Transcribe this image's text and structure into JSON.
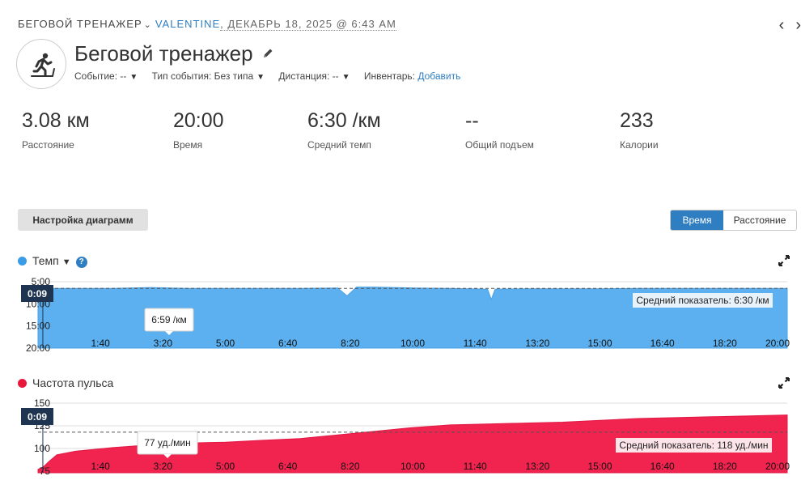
{
  "header": {
    "activity_name": "БЕГОВОЙ ТРЕНАЖЕР",
    "user": "VALENTINE",
    "date_time": ", ДЕКАБРЬ 18, 2025 @ 6:43 AM",
    "prev_symbol": "‹",
    "next_symbol": "›"
  },
  "activity": {
    "title": "Беговой тренажер",
    "icon": "treadmill-runner-icon",
    "meta": {
      "event_label": "Событие: --",
      "event_type_label": "Тип события: Без типа",
      "distance_label": "Дистанция: --",
      "gear_label": "Инвентарь:",
      "gear_link": "Добавить"
    }
  },
  "stats": [
    {
      "value": "3.08 км",
      "label": "Расстояние"
    },
    {
      "value": "20:00",
      "label": "Время"
    },
    {
      "value": "6:30 /км",
      "label": "Средний темп"
    },
    {
      "value": "--",
      "label": "Общий подъем"
    },
    {
      "value": "233",
      "label": "Калории"
    }
  ],
  "controls": {
    "settings_button": "Настройка диаграмм",
    "x_axis_time": "Время",
    "x_axis_distance": "Расстояние"
  },
  "colors": {
    "accent": "#2f7ec1",
    "pace": "#5cb0ef",
    "pace_dot": "#3a9be6",
    "heart_rate": "#f0244e",
    "heart_rate_dot": "#e8173c",
    "marker_bg": "#1e3450"
  },
  "chart_data": [
    {
      "type": "area",
      "title": "Темп",
      "unit": "/км",
      "y_ticks": [
        "5:00",
        "10:00",
        "15:00",
        "20:00"
      ],
      "y_tick_minutes": [
        5,
        10,
        15,
        20
      ],
      "y_inverted": true,
      "x_ticks": [
        "1:40",
        "3:20",
        "5:00",
        "6:40",
        "8:20",
        "10:00",
        "11:40",
        "13:20",
        "15:00",
        "16:40",
        "18:20",
        "20:00"
      ],
      "x_minutes": [
        0,
        1,
        2,
        3,
        4,
        5,
        6,
        7,
        8,
        8.25,
        8.5,
        9,
        10,
        11,
        12,
        12.1,
        12.2,
        13,
        14,
        15,
        16,
        17,
        18,
        19,
        20
      ],
      "pace_minutes": [
        6.5,
        6.5,
        6.5,
        6.3,
        6.5,
        6.5,
        6.5,
        6.5,
        6.4,
        8.2,
        6.2,
        6.2,
        6.4,
        6.5,
        6.7,
        9.0,
        6.7,
        6.6,
        6.6,
        6.6,
        6.5,
        6.5,
        6.5,
        6.5,
        6.5
      ],
      "average_label": "Средний показатель: 6:30 /км",
      "average_value": 6.5,
      "marker_label": "0:09",
      "tooltip": "6:59 /км"
    },
    {
      "type": "area",
      "title": "Частота пульса",
      "unit": "уд./мин",
      "y_ticks": [
        "150",
        "125",
        "100",
        "75"
      ],
      "y_tick_values": [
        150,
        125,
        100,
        75
      ],
      "ylim": [
        75,
        150
      ],
      "x_ticks": [
        "1:40",
        "3:20",
        "5:00",
        "6:40",
        "8:20",
        "10:00",
        "11:40",
        "13:20",
        "15:00",
        "16:40",
        "18:20",
        "20:00"
      ],
      "x_minutes": [
        0,
        0.15,
        0.3,
        0.5,
        1,
        2,
        3,
        4,
        5,
        6,
        7,
        8,
        9,
        10,
        11,
        12,
        13,
        14,
        15,
        16,
        17,
        18,
        19,
        20
      ],
      "hr_values": [
        77,
        80,
        86,
        93,
        97,
        101,
        104,
        106,
        107,
        109,
        111,
        115,
        119,
        123,
        126,
        127,
        128,
        129,
        131,
        133,
        134,
        135,
        136,
        137
      ],
      "average_label": "Средний показатель: 118 уд./мин",
      "average_value": 118,
      "marker_label": "0:09",
      "tooltip": "77 уд./мин"
    }
  ]
}
